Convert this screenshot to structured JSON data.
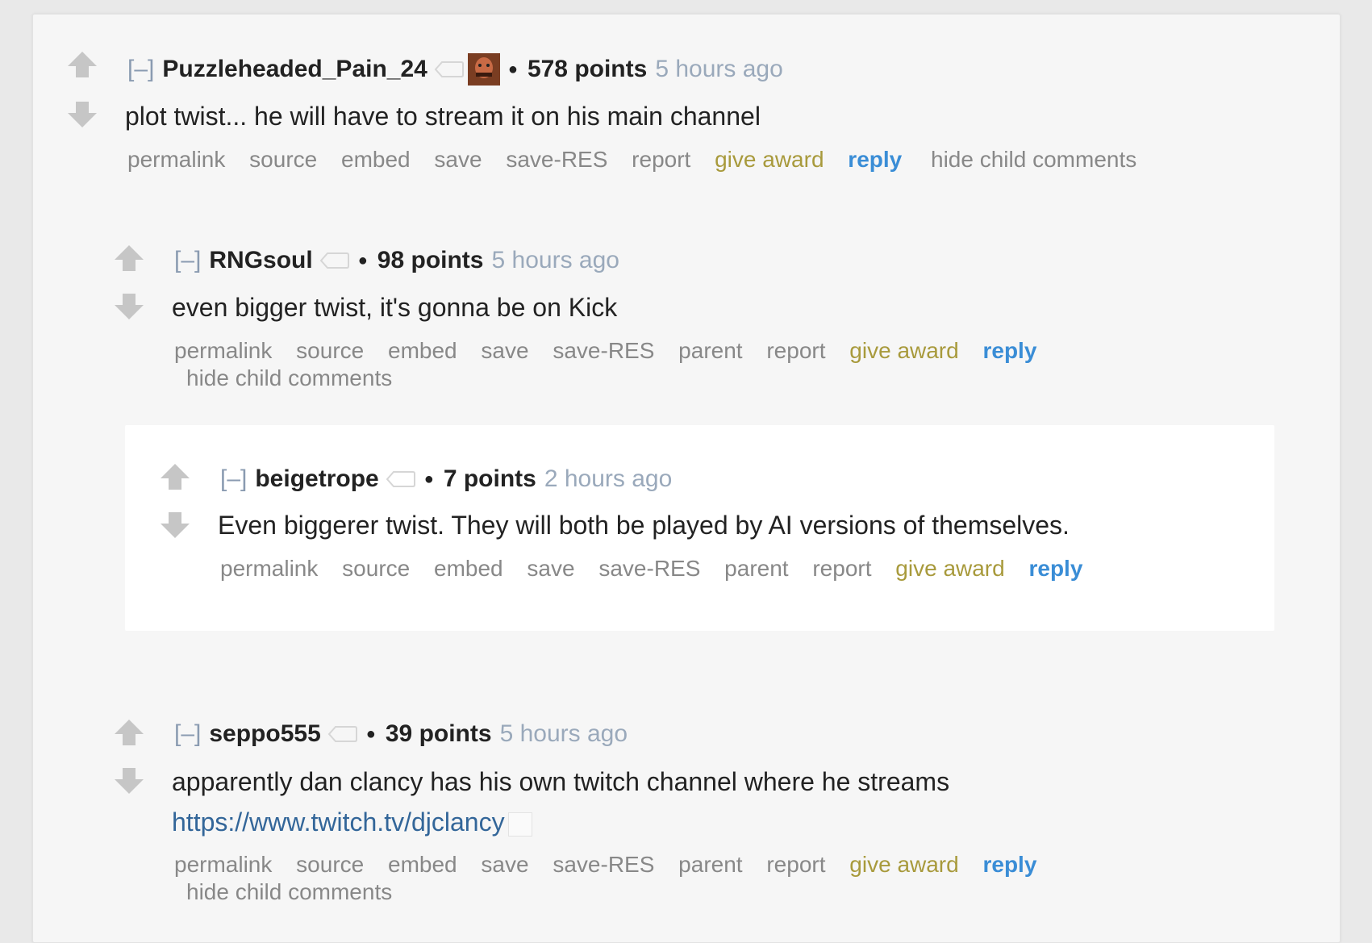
{
  "comments": [
    {
      "collapse": "[–]",
      "author": "Puzzleheaded_Pain_24",
      "score": "578 points",
      "time": "5 hours ago",
      "body": "plot twist... he will have to stream it on his main channel",
      "actions": {
        "permalink": "permalink",
        "source": "source",
        "embed": "embed",
        "save": "save",
        "save_res": "save-RES",
        "report": "report",
        "give_award": "give award",
        "reply": "reply",
        "hide_child": "hide child comments"
      }
    },
    {
      "collapse": "[–]",
      "author": "RNGsoul",
      "score": "98 points",
      "time": "5 hours ago",
      "body": "even bigger twist, it's gonna be on Kick",
      "actions": {
        "permalink": "permalink",
        "source": "source",
        "embed": "embed",
        "save": "save",
        "save_res": "save-RES",
        "parent": "parent",
        "report": "report",
        "give_award": "give award",
        "reply": "reply",
        "hide_child": "hide child comments"
      }
    },
    {
      "collapse": "[–]",
      "author": "beigetrope",
      "score": "7 points",
      "time": "2 hours ago",
      "body": "Even biggerer twist. They will both be played by AI versions of themselves.",
      "actions": {
        "permalink": "permalink",
        "source": "source",
        "embed": "embed",
        "save": "save",
        "save_res": "save-RES",
        "parent": "parent",
        "report": "report",
        "give_award": "give award",
        "reply": "reply"
      }
    },
    {
      "collapse": "[–]",
      "author": "seppo555",
      "score": "39 points",
      "time": "5 hours ago",
      "body": "apparently dan clancy has his own twitch channel where he streams",
      "link": "https://www.twitch.tv/djclancy",
      "actions": {
        "permalink": "permalink",
        "source": "source",
        "embed": "embed",
        "save": "save",
        "save_res": "save-RES",
        "parent": "parent",
        "report": "report",
        "give_award": "give award",
        "reply": "reply",
        "hide_child": "hide child comments"
      }
    }
  ],
  "colors": {
    "author": "#222222",
    "time": "#9aa9bb",
    "action": "#888888",
    "give_award": "#a89a3c",
    "reply": "#3a8dd6",
    "link": "#336699",
    "child_background": "#ffffff",
    "panel_background": "#f6f6f6"
  },
  "icons": [
    "upvote-arrow-icon",
    "downvote-arrow-icon",
    "flair-tag-icon",
    "user-avatar"
  ]
}
